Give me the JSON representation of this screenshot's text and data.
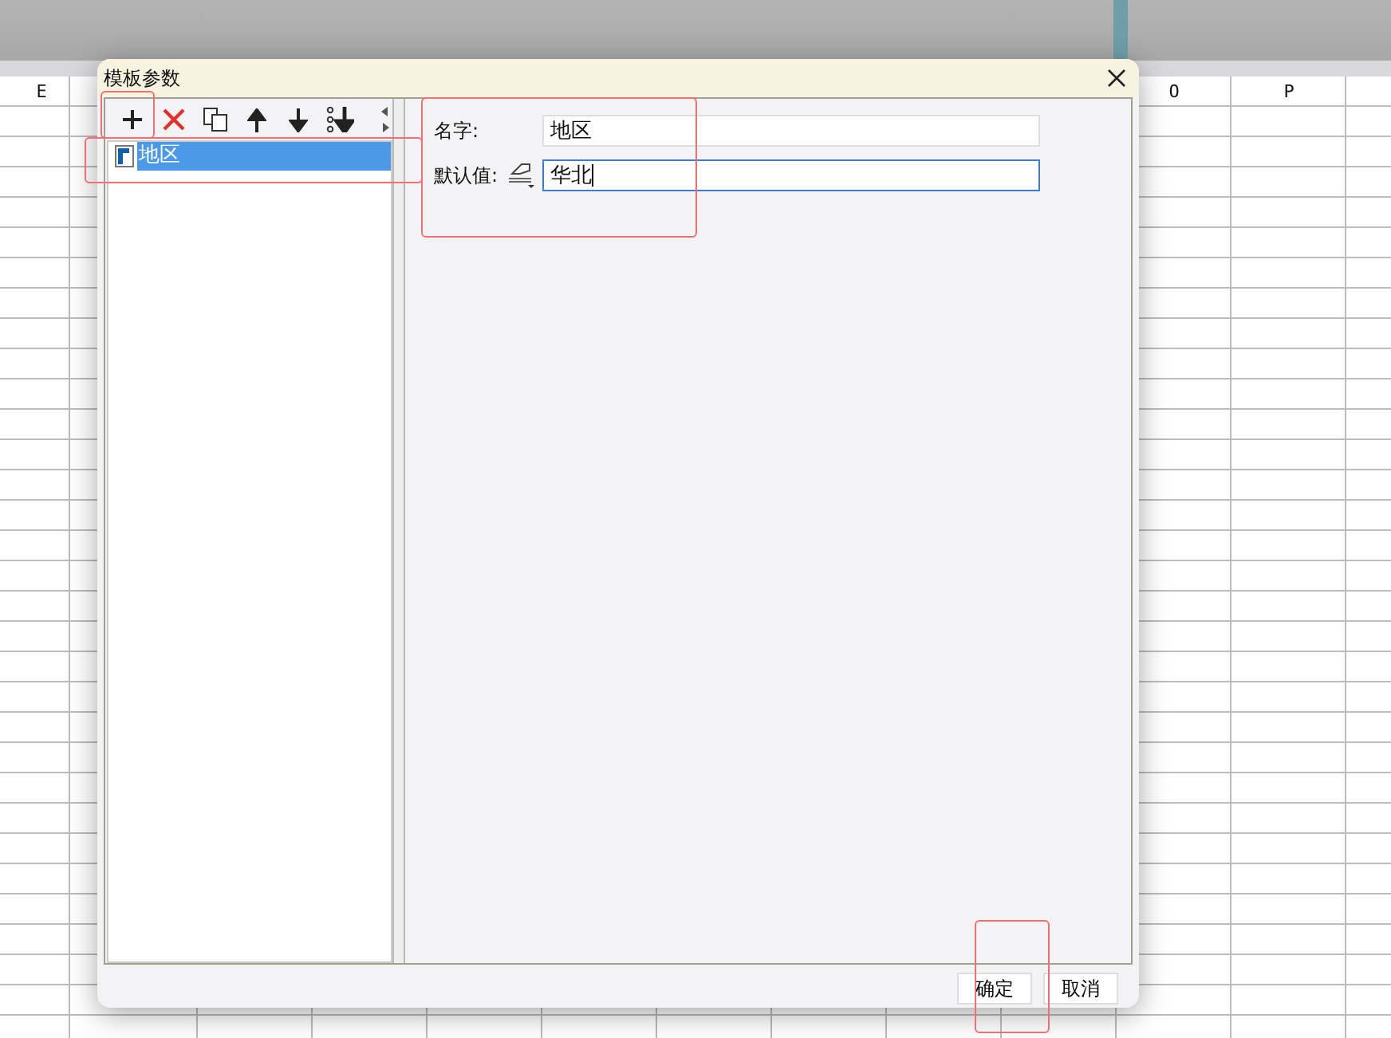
{
  "spreadsheet": {
    "column_headers": [
      "E",
      "O",
      "P"
    ]
  },
  "dialog": {
    "title": "模板参数",
    "toolbar": [
      {
        "kind": "add"
      },
      {
        "kind": "delete"
      },
      {
        "kind": "copy"
      },
      {
        "kind": "up"
      },
      {
        "kind": "down"
      },
      {
        "kind": "bottom"
      }
    ],
    "tree": [
      {
        "label": "地区",
        "selected": true
      }
    ],
    "fields": [
      {
        "label": "名字:",
        "value": "地区",
        "focused": false,
        "kind": "text"
      },
      {
        "label": "默认值:",
        "value": "华北",
        "focused": true,
        "kind": "typed"
      }
    ],
    "buttons": [
      "确定",
      "取消"
    ]
  }
}
